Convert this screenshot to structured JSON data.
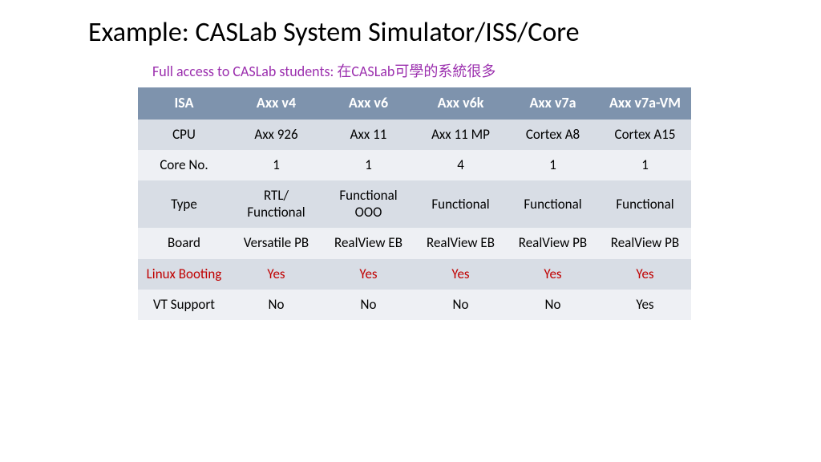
{
  "title": "Example: CASLab System Simulator/ISS/Core",
  "subtitle": "Full access to CASLab students: 在CASLab可學的系統很多",
  "table": {
    "headers": [
      "ISA",
      "Axx v4",
      "Axx v6",
      "Axx v6k",
      "Axx v7a",
      "Axx v7a-VM"
    ],
    "rows": [
      {
        "label": "CPU",
        "cells": [
          "Axx 926",
          "Axx 11",
          "Axx 11 MP",
          "Cortex A8",
          "Cortex A15"
        ],
        "highlight": false
      },
      {
        "label": "Core No.",
        "cells": [
          "1",
          "1",
          "4",
          "1",
          "1"
        ],
        "highlight": false
      },
      {
        "label": "Type",
        "cells": [
          "RTL/ Functional",
          "Functional OOO",
          "Functional",
          "Functional",
          "Functional"
        ],
        "highlight": false
      },
      {
        "label": "Board",
        "cells": [
          "Versatile PB",
          "RealView EB",
          "RealView EB",
          "RealView PB",
          "RealView PB"
        ],
        "highlight": false
      },
      {
        "label": "Linux Booting",
        "cells": [
          "Yes",
          "Yes",
          "Yes",
          "Yes",
          "Yes"
        ],
        "highlight": true
      },
      {
        "label": "VT Support",
        "cells": [
          "No",
          "No",
          "No",
          "No",
          "Yes"
        ],
        "highlight": false
      }
    ]
  }
}
